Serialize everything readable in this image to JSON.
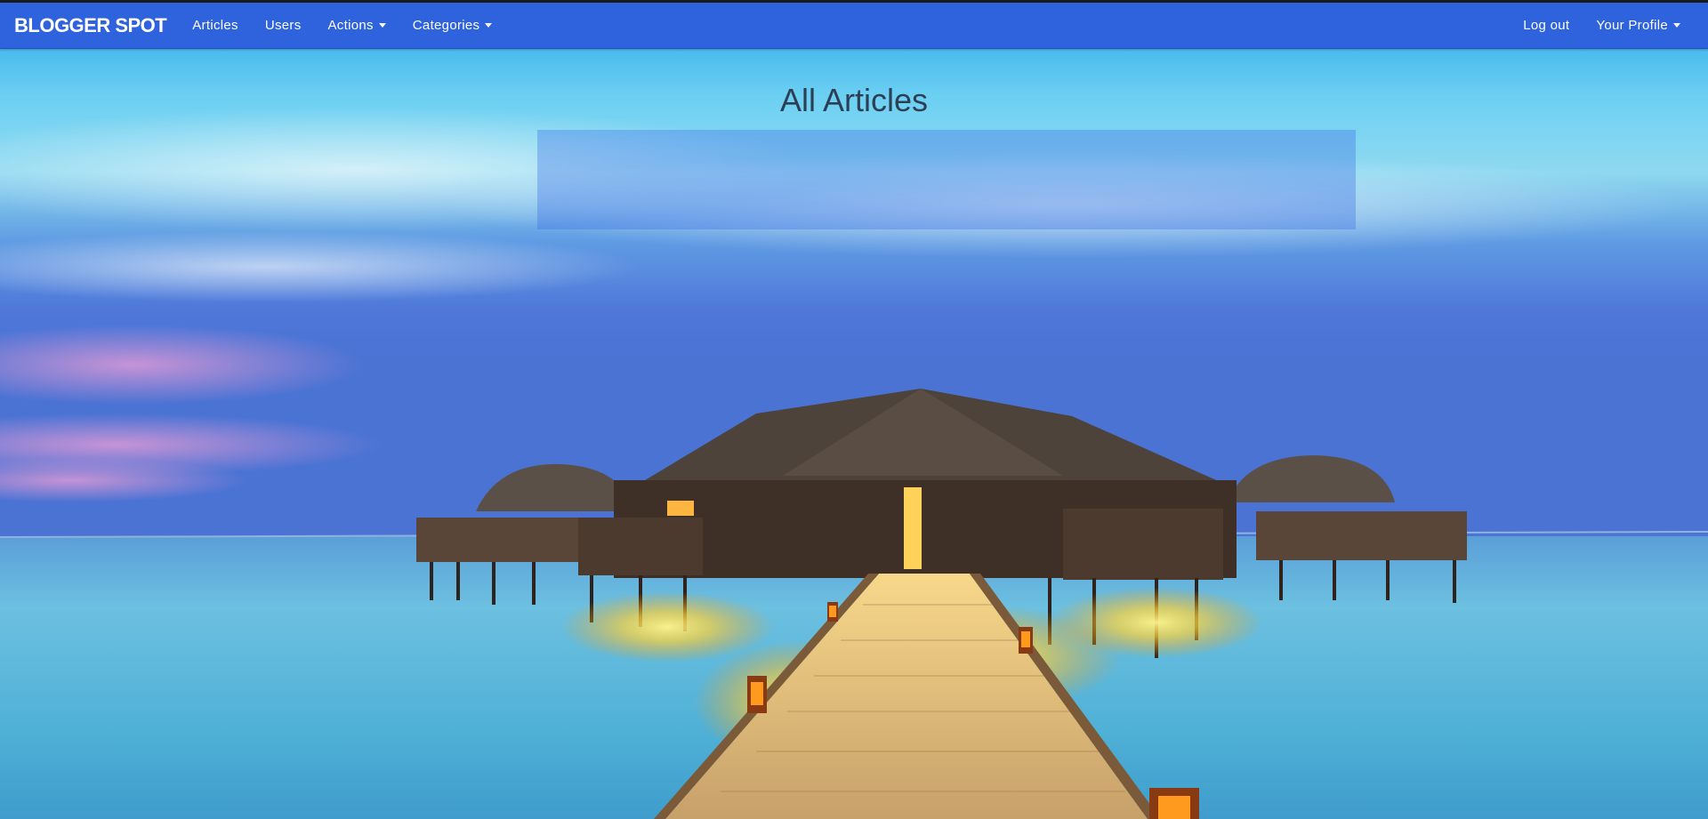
{
  "navbar": {
    "brand": "BLOGGER SPOT",
    "left_items": [
      {
        "label": "Articles",
        "dropdown": false
      },
      {
        "label": "Users",
        "dropdown": false
      },
      {
        "label": "Actions",
        "dropdown": true
      },
      {
        "label": "Categories",
        "dropdown": true
      }
    ],
    "right_items": [
      {
        "label": "Log out",
        "dropdown": false
      },
      {
        "label": "Your Profile",
        "dropdown": true
      }
    ],
    "background_color": "#2f62dd"
  },
  "main": {
    "title": "All Articles"
  },
  "background": {
    "description_icon": "overwater-villa-photo"
  }
}
